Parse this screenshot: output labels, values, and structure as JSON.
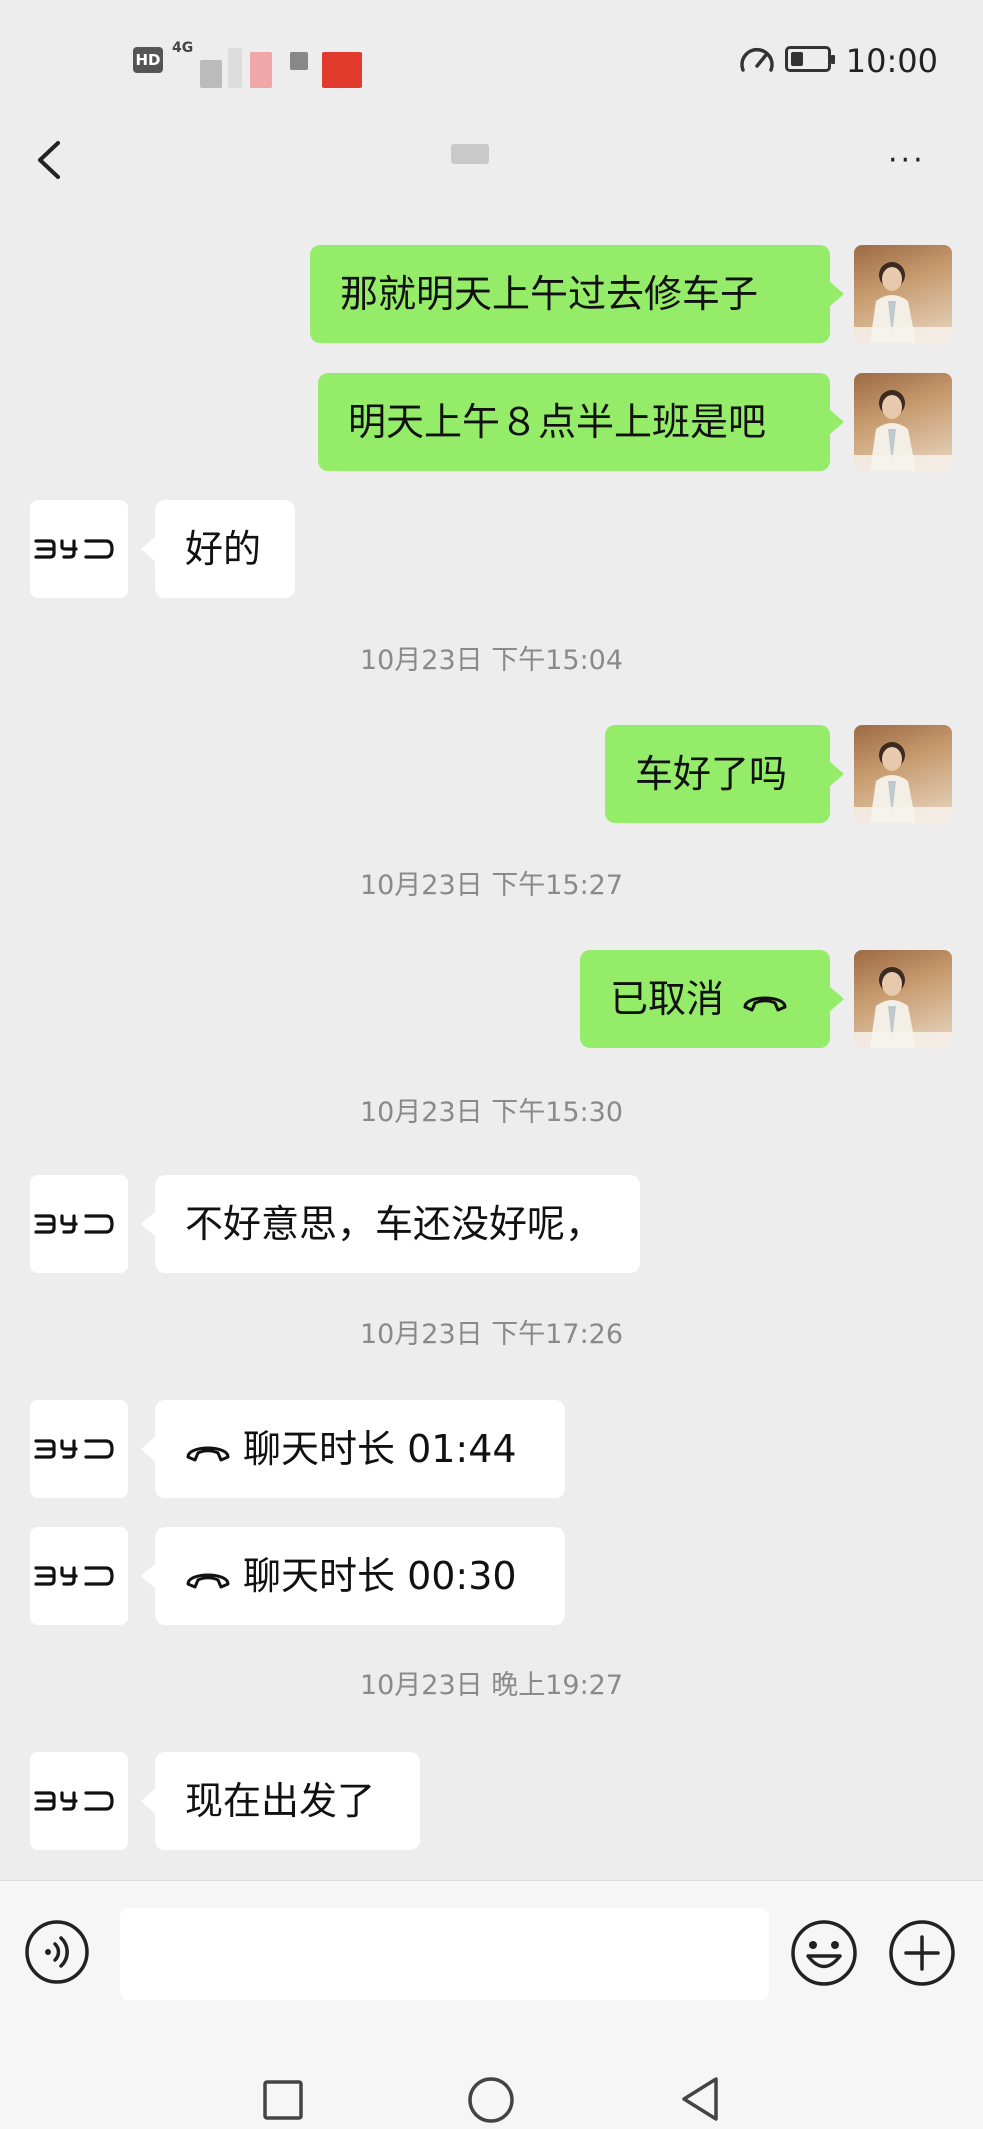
{
  "status_bar": {
    "hd_label": "HD",
    "network_label": "4G",
    "time": "10:00",
    "battery_level": 0.35
  },
  "nav": {
    "back_icon": "chevron-left-icon",
    "more_icon": "more-dots-icon",
    "more_label": "···"
  },
  "messages": [
    {
      "side": "me",
      "text": "那就明天上午过去修车子"
    },
    {
      "side": "me",
      "text": "明天上午８点半上班是吧"
    },
    {
      "side": "them",
      "text": "好的"
    },
    {
      "timestamp": "10月23日 下午15:04"
    },
    {
      "side": "me",
      "text": "车好了吗"
    },
    {
      "timestamp": "10月23日 下午15:27"
    },
    {
      "side": "me",
      "text": "已取消",
      "icon": "phone-hangup-icon"
    },
    {
      "timestamp": "10月23日 下午15:30"
    },
    {
      "side": "them",
      "text": "不好意思，车还没好呢，"
    },
    {
      "timestamp": "10月23日 下午17:26"
    },
    {
      "side": "them",
      "text": "聊天时长 01:44",
      "icon": "phone-hangup-icon"
    },
    {
      "side": "them",
      "text": "聊天时长 00:30",
      "icon": "phone-hangup-icon"
    },
    {
      "timestamp": "10月23日 晚上19:27"
    },
    {
      "side": "them",
      "text": "现在出发了"
    }
  ],
  "contact_avatar_label": "BYD",
  "input_bar": {
    "voice_icon": "voice-icon",
    "emoji_icon": "emoji-icon",
    "plus_icon": "plus-circle-icon",
    "input_value": ""
  },
  "system_nav": {
    "recent_icon": "square-icon",
    "home_icon": "circle-icon",
    "back_icon": "triangle-back-icon"
  },
  "colors": {
    "background": "#ededed",
    "my_bubble": "#95ec69",
    "their_bubble": "#ffffff",
    "timestamp": "#8a8a8a"
  }
}
